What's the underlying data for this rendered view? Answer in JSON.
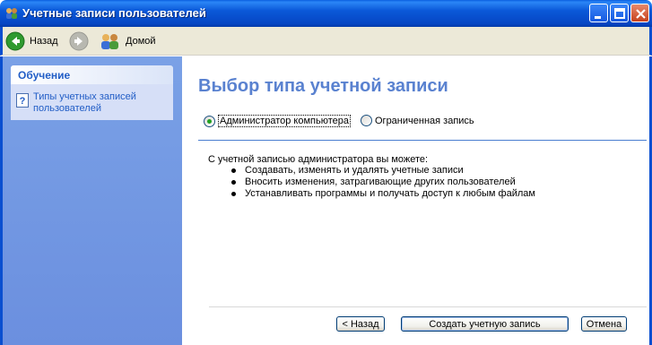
{
  "window": {
    "title": "Учетные записи пользователей"
  },
  "toolbar": {
    "back_label": "Назад",
    "home_label": "Домой"
  },
  "sidebar": {
    "header": "Обучение",
    "link": "Типы учетных записей пользователей"
  },
  "main": {
    "title": "Выбор типа учетной записи",
    "options": [
      {
        "label": "Администратор компьютера",
        "selected": true
      },
      {
        "label": "Ограниченная запись",
        "selected": false
      }
    ],
    "description": "С учетной записью администратора вы можете:",
    "bullets": [
      "Создавать, изменять и удалять учетные записи",
      "Вносить изменения, затрагивающие других пользователей",
      "Устанавливать программы и получать доступ к любым файлам"
    ]
  },
  "buttons": {
    "back": "< Назад",
    "create": "Создать учетную запись",
    "cancel": "Отмена"
  },
  "colors": {
    "title_bar": "#0a58d8",
    "sidebar": "#7aa1e6",
    "page_title": "#5a82d0",
    "link": "#215dc6"
  }
}
